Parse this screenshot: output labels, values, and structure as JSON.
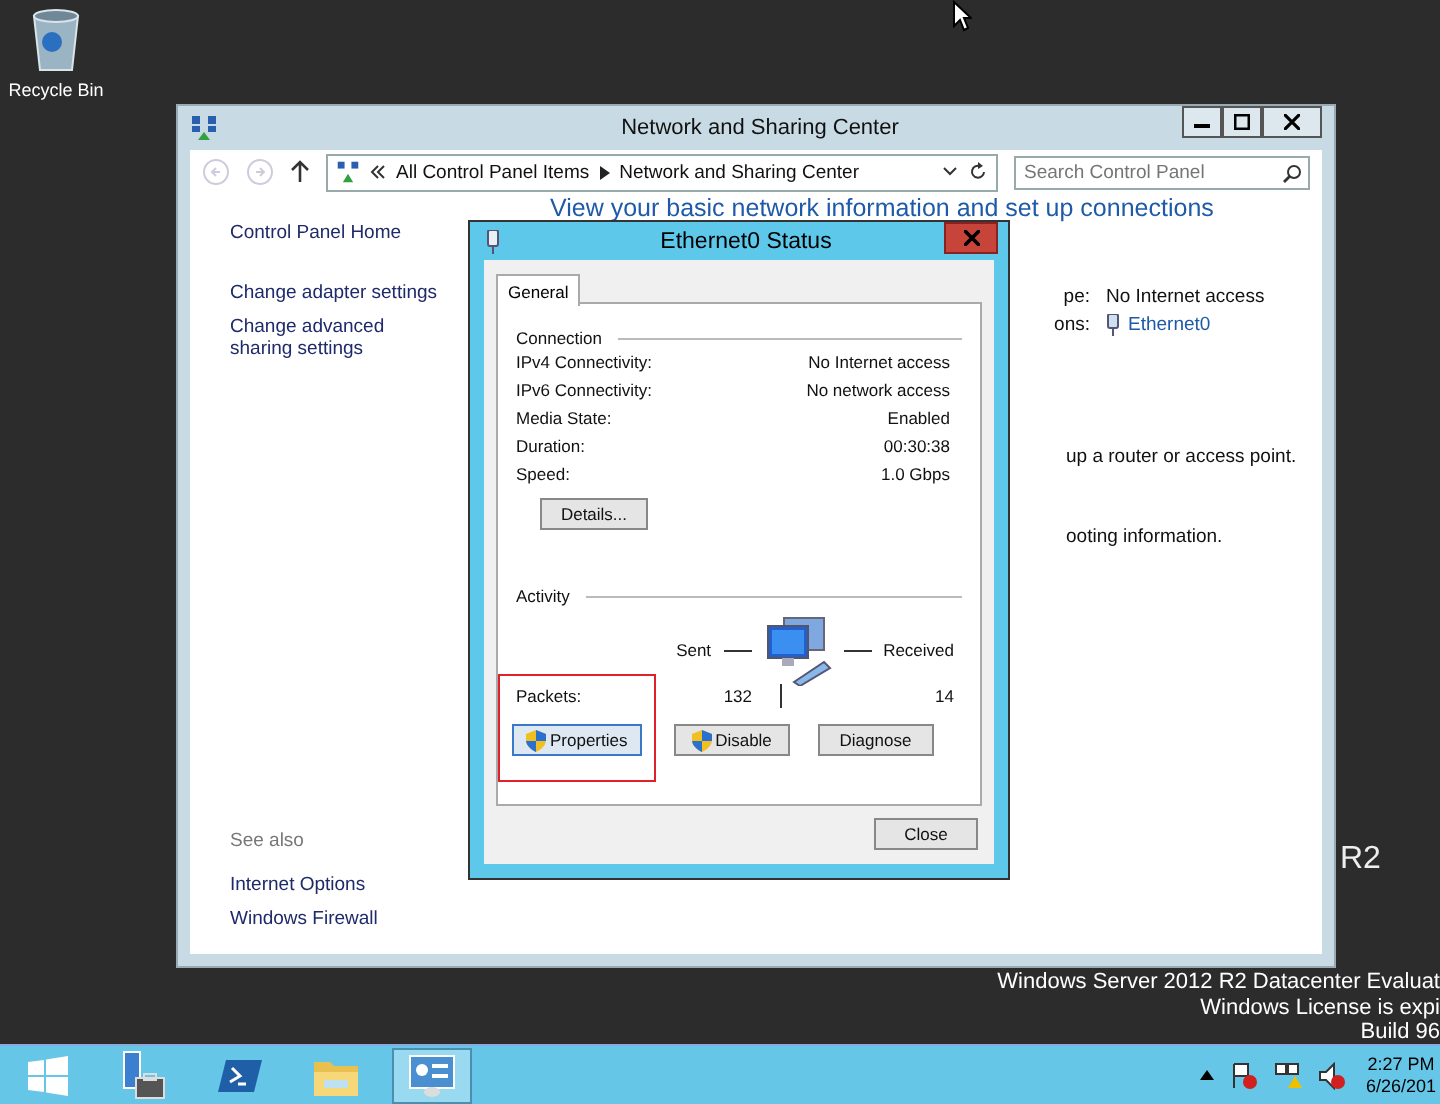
{
  "desktop": {
    "icons": [
      {
        "label": "Recycle Bin"
      }
    ],
    "side_text": "R2",
    "watermark": [
      "Windows Server 2012 R2 Datacenter Evaluat",
      "Windows License is expi",
      "Build 96"
    ]
  },
  "main_window": {
    "title": "Network and Sharing Center",
    "address": {
      "crumbs": [
        "All Control Panel Items",
        "Network and Sharing Center"
      ]
    },
    "search": {
      "placeholder": "Search Control Panel"
    },
    "sidebar": {
      "items": [
        "Control Panel Home",
        "Change adapter settings",
        "Change advanced sharing settings"
      ],
      "see_also": {
        "title": "See also",
        "items": [
          "Internet Options",
          "Windows Firewall"
        ]
      }
    },
    "content": {
      "heading": "View your basic network information and set up connections",
      "access_label": "pe:",
      "access_value": "No Internet access",
      "connections_label": "ons:",
      "connection_link": "Ethernet0",
      "fragments": [
        "up a router or access point.",
        "ooting information."
      ]
    }
  },
  "dialog": {
    "title": "Ethernet0 Status",
    "tabs": [
      {
        "label": "General",
        "selected": true
      }
    ],
    "connection": {
      "title": "Connection",
      "rows": [
        {
          "label": "IPv4 Connectivity:",
          "value": "No Internet access"
        },
        {
          "label": "IPv6 Connectivity:",
          "value": "No network access"
        },
        {
          "label": "Media State:",
          "value": "Enabled"
        },
        {
          "label": "Duration:",
          "value": "00:30:38"
        },
        {
          "label": "Speed:",
          "value": "1.0 Gbps"
        }
      ],
      "details_button": "Details..."
    },
    "activity": {
      "title": "Activity",
      "sent_label": "Sent",
      "received_label": "Received",
      "packets_label": "Packets:",
      "sent": "132",
      "received": "14"
    },
    "buttons": [
      {
        "label": "Properties",
        "shield": true,
        "highlighted": true
      },
      {
        "label": "Disable",
        "shield": true,
        "highlighted": false
      },
      {
        "label": "Diagnose",
        "shield": false,
        "highlighted": false
      }
    ],
    "close_button": "Close"
  },
  "taskbar": {
    "items": [
      {
        "kind": "start",
        "selected": false
      },
      {
        "kind": "server",
        "selected": false
      },
      {
        "kind": "shell",
        "selected": false
      },
      {
        "kind": "folder",
        "selected": false
      },
      {
        "kind": "control",
        "selected": true
      }
    ],
    "time": "2:27 PM",
    "date": "6/26/201"
  }
}
